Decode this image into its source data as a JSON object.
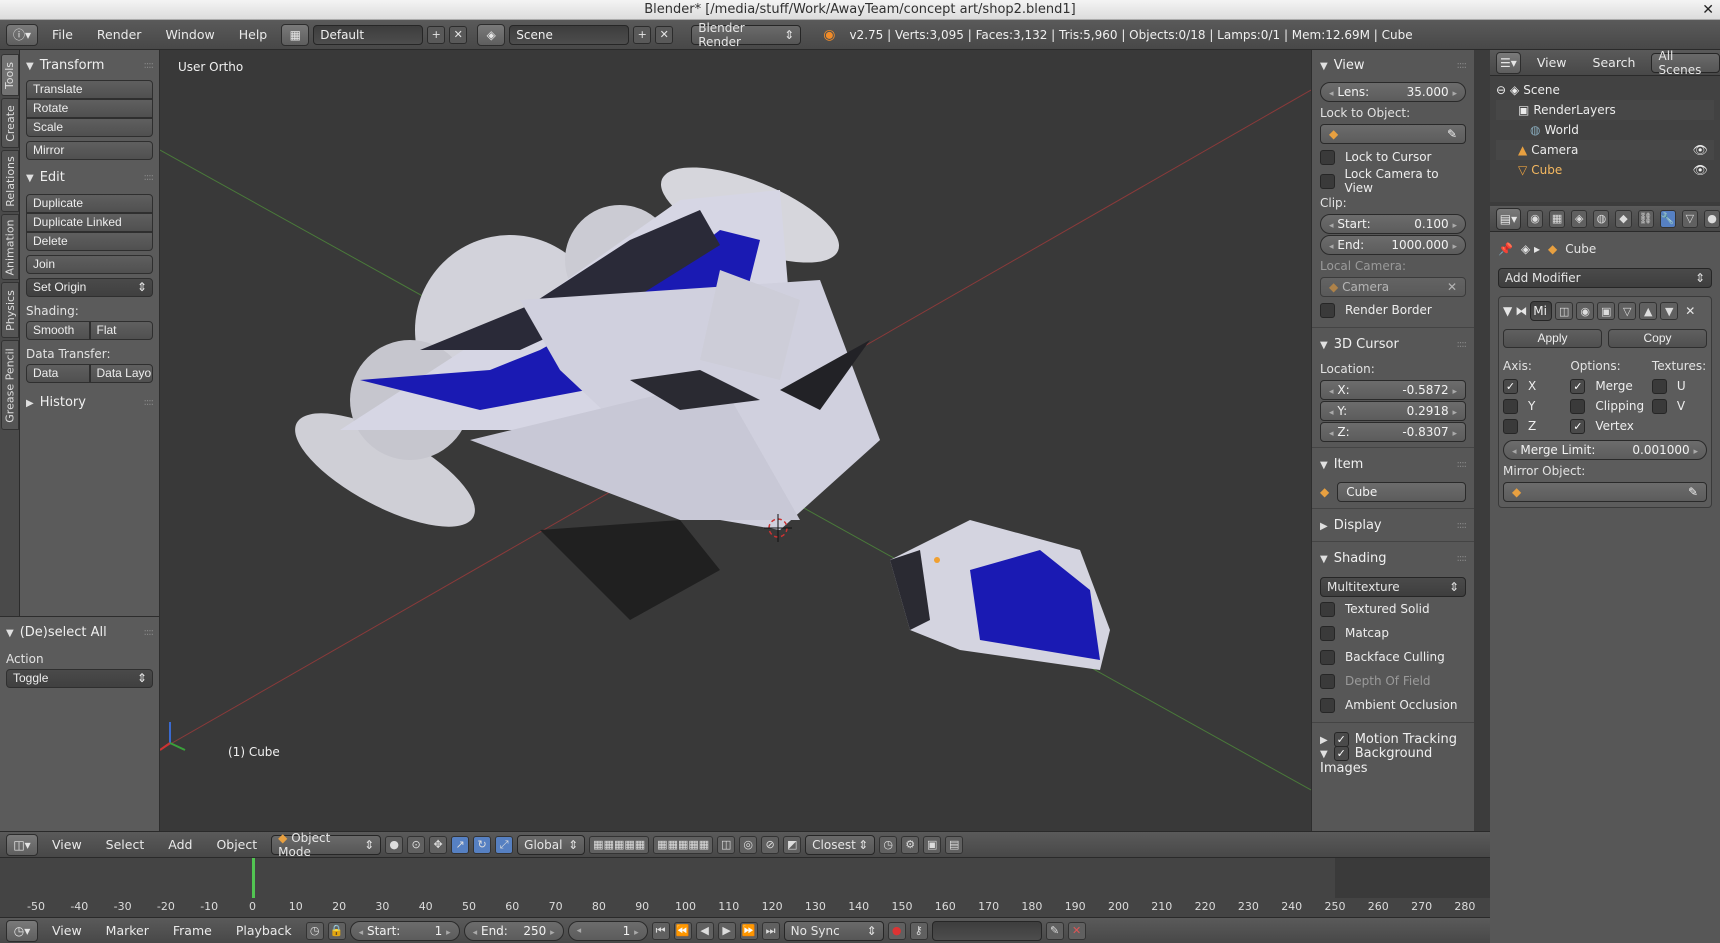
{
  "window": {
    "title": "Blender* [/media/stuff/Work/AwayTeam/concept art/shop2.blend1]",
    "close": "✕"
  },
  "topbar": {
    "menus": [
      "File",
      "Render",
      "Window",
      "Help"
    ],
    "layout": "Default",
    "scene": "Scene",
    "engine": "Blender Render",
    "stats": "v2.75 | Verts:3,095 | Faces:3,132 | Tris:5,960 | Objects:0/18 | Lamps:0/1 | Mem:12.69M | Cube"
  },
  "tabs": [
    "Tools",
    "Create",
    "Relations",
    "Animation",
    "Physics",
    "Grease Pencil"
  ],
  "toolshelf": {
    "transform": {
      "title": "Transform",
      "buttons": [
        "Translate",
        "Rotate",
        "Scale"
      ],
      "mirror": "Mirror"
    },
    "edit": {
      "title": "Edit",
      "buttons": [
        "Duplicate",
        "Duplicate Linked",
        "Delete"
      ],
      "join": "Join",
      "set_origin": "Set Origin",
      "shading_label": "Shading:",
      "smooth": "Smooth",
      "flat": "Flat",
      "transfer_label": "Data Transfer:",
      "data": "Data",
      "data_layout": "Data Layo"
    },
    "history": "History"
  },
  "operator": {
    "title": "(De)select All",
    "action_label": "Action",
    "action": "Toggle"
  },
  "viewport": {
    "view_label": "User Ortho",
    "object_label": "(1) Cube"
  },
  "npanel": {
    "view": {
      "title": "View",
      "lens_label": "Lens:",
      "lens": "35.000",
      "lock_label": "Lock to Object:",
      "lock_cursor": "Lock to Cursor",
      "lock_camera": "Lock Camera to View",
      "clip_label": "Clip:",
      "start_label": "Start:",
      "start": "0.100",
      "end_label": "End:",
      "end": "1000.000",
      "local_camera": "Local Camera:",
      "camera": "Camera",
      "render_border": "Render Border"
    },
    "cursor": {
      "title": "3D Cursor",
      "location": "Location:",
      "x_label": "X:",
      "x": "-0.5872",
      "y_label": "Y:",
      "y": "0.2918",
      "z_label": "Z:",
      "z": "-0.8307"
    },
    "item": {
      "title": "Item",
      "name": "Cube"
    },
    "display": "Display",
    "shading": {
      "title": "Shading",
      "mode": "Multitexture",
      "textured_solid": "Textured Solid",
      "matcap": "Matcap",
      "backface": "Backface Culling",
      "dof": "Depth Of Field",
      "ao": "Ambient Occlusion"
    },
    "motion_tracking": "Motion Tracking",
    "background_images": "Background Images"
  },
  "outliner": {
    "view": "View",
    "search": "Search",
    "all_scenes": "All Scenes",
    "rows": [
      "Scene",
      "RenderLayers",
      "World",
      "Camera",
      "Cube"
    ]
  },
  "properties": {
    "object": "Cube",
    "add_modifier": "Add Modifier",
    "modifier_name": "Mi",
    "apply": "Apply",
    "copy": "Copy",
    "axis_label": "Axis:",
    "options_label": "Options:",
    "textures_label": "Textures:",
    "x": "X",
    "y": "Y",
    "z": "Z",
    "merge": "Merge",
    "clipping": "Clipping",
    "vertex": "Vertex",
    "u": "U",
    "v": "V",
    "merge_limit_label": "Merge Limit:",
    "merge_limit": "0.001000",
    "mirror_object": "Mirror Object:"
  },
  "vp_header": {
    "menus": [
      "View",
      "Select",
      "Add",
      "Object"
    ],
    "mode": "Object Mode",
    "orientation": "Global",
    "snap": "Closest"
  },
  "timeline": {
    "ticks": [
      "-50",
      "-40",
      "-30",
      "-20",
      "-10",
      "0",
      "10",
      "20",
      "30",
      "40",
      "50",
      "60",
      "70",
      "80",
      "90",
      "100",
      "110",
      "120",
      "130",
      "140",
      "150",
      "160",
      "170",
      "180",
      "190",
      "200",
      "210",
      "220",
      "230",
      "240",
      "250",
      "260",
      "270",
      "280"
    ],
    "current_frame": 0
  },
  "tl_header": {
    "menus": [
      "View",
      "Marker",
      "Frame",
      "Playback"
    ],
    "start_label": "Start:",
    "start": "1",
    "end_label": "End:",
    "end": "250",
    "frame": "1",
    "sync": "No Sync"
  },
  "colors": {
    "blue_panel": "#1a1ab3",
    "hull": "#d8d8e6",
    "accent": "#5680c2"
  }
}
